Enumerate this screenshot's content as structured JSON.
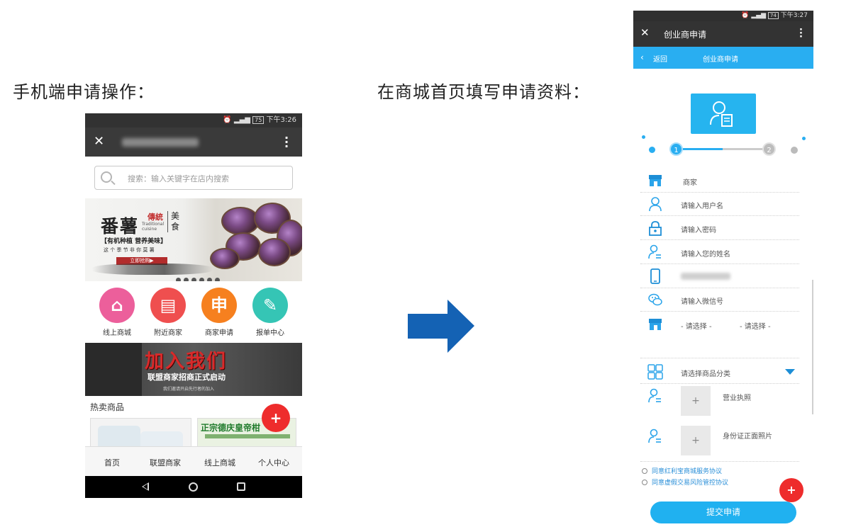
{
  "headings": {
    "left": "手机端申请操作：",
    "right": "在商城首页填写申请资料："
  },
  "phone1": {
    "status_time": "下午3:26",
    "status_battery": "75",
    "search_placeholder": "搜索：输入关键字在店内搜索",
    "banner": {
      "title": "番薯",
      "tag_red": "傳統",
      "tag_en_1": "Traditional",
      "tag_en_2": "cuisine",
      "tag_meishi": "美食",
      "slogan": "【有机种植  营养美味】",
      "subline": "这 个 季 节    非 你 莫 薯",
      "buy_button": "立即抢购▶"
    },
    "categories": [
      {
        "label": "线上商城",
        "color": "#ec5f9b",
        "glyph": "⌂"
      },
      {
        "label": "附近商家",
        "color": "#ef4f4f",
        "glyph": "▤"
      },
      {
        "label": "商家申请",
        "color": "#f6801f",
        "glyph": "申"
      },
      {
        "label": "报单中心",
        "color": "#35c5b5",
        "glyph": "✎"
      }
    ],
    "join_banner": {
      "title": "加入我们",
      "subtitle": "联盟商家招商正式启动",
      "small": "我们邀请开启先行者的加入"
    },
    "hot_label": "热卖商品",
    "product2_text": "正宗德庆皇帝柑",
    "fab": "+",
    "bottom_nav": [
      "首页",
      "联盟商家",
      "线上商城",
      "个人中心"
    ]
  },
  "phone2": {
    "status_time": "下午3:27",
    "status_battery": "74",
    "title": "创业商申请",
    "back": "返回",
    "subtitle": "创业商申请",
    "steps": [
      "1",
      "2"
    ],
    "rows": [
      {
        "icon": "store-icon",
        "text": "商家"
      },
      {
        "icon": "user-icon",
        "text": "请输入用户名"
      },
      {
        "icon": "lock-icon",
        "text": "请输入密码"
      },
      {
        "icon": "person-icon",
        "text": "请输入您的姓名"
      },
      {
        "icon": "phone-icon",
        "text": ""
      },
      {
        "icon": "wechat-icon",
        "text": "请输入微信号"
      },
      {
        "icon": "store-icon",
        "text": "- 请选择 -"
      }
    ],
    "select2": "- 请选择 -",
    "category_text": "请选择商品分类",
    "upload1_label": "营业执照",
    "upload2_label": "身份证正面照片",
    "upload_plus": "+",
    "agree1": "同意红利宝商城服务协议",
    "agree2": "同意虚假交易风险管控协议",
    "fab": "+",
    "submit": "提交申请",
    "accent": "#29aef1"
  }
}
